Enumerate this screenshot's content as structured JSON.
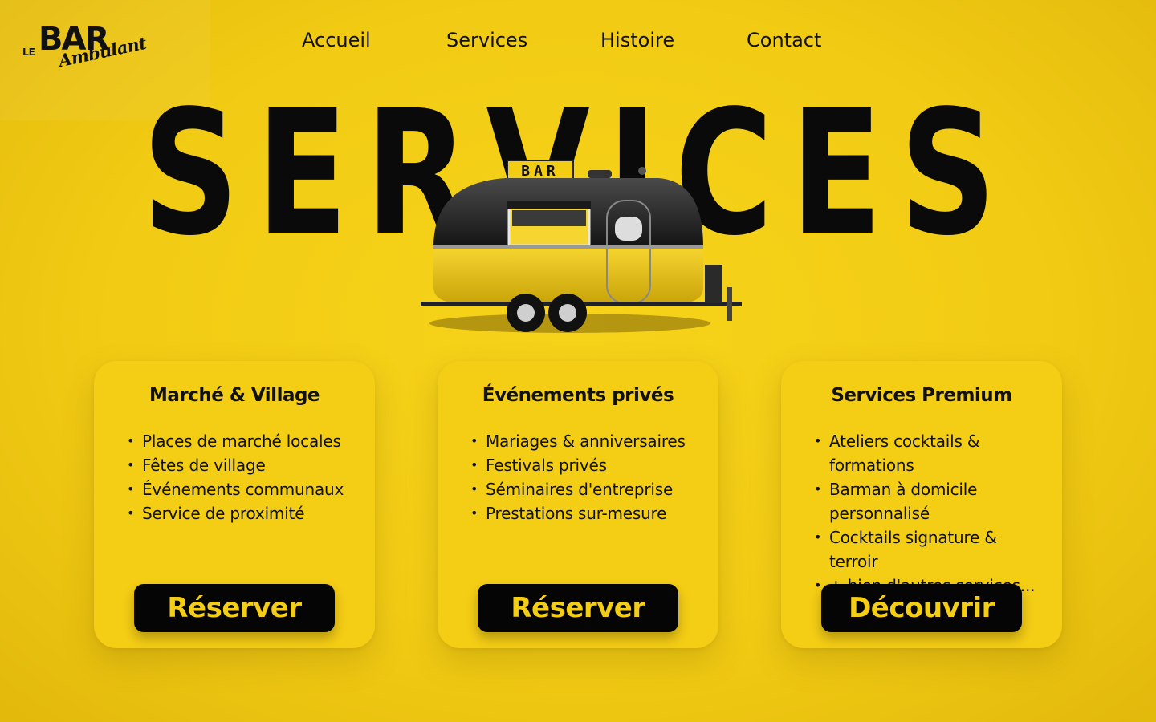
{
  "colors": {
    "accent": "#f4cd15",
    "text": "#111111",
    "button_bg": "#050505"
  },
  "brand": {
    "le": "LE",
    "bar": "BAR",
    "ambulant": "Ambulant"
  },
  "nav": {
    "items": [
      {
        "label": "Accueil"
      },
      {
        "label": "Services"
      },
      {
        "label": "Histoire"
      },
      {
        "label": "Contact"
      }
    ]
  },
  "hero": {
    "title": "SERVICES",
    "sign_label": "BAR"
  },
  "cards": [
    {
      "title": "Marché & Village",
      "items": [
        "Places de marché locales",
        "Fêtes de village",
        "Événements communaux",
        "Service de proximité"
      ],
      "button_label": "Réserver"
    },
    {
      "title": "Événements privés",
      "items": [
        "Mariages & anniversaires",
        "Festivals privés",
        "Séminaires d'entreprise",
        "Prestations sur-mesure"
      ],
      "button_label": "Réserver"
    },
    {
      "title": "Services Premium",
      "items": [
        "Ateliers cocktails & formations",
        "Barman à domicile personnalisé",
        "Cocktails signature & terroir",
        "+ bien d'autres services..."
      ],
      "button_label": "Découvrir"
    }
  ],
  "icons": {
    "logo": "le-bar-ambulant-logo",
    "hero_image": "food-trailer-image"
  }
}
